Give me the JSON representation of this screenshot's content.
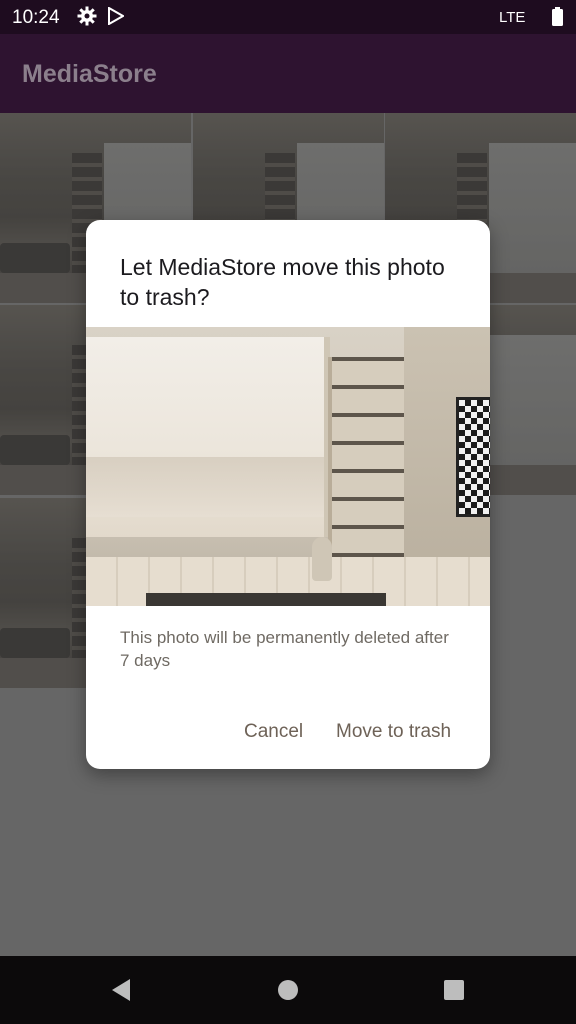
{
  "status_bar": {
    "time": "10:24",
    "network": "LTE",
    "icons": [
      "gear-icon",
      "play-store-icon",
      "battery-icon"
    ]
  },
  "app_bar": {
    "title": "MediaStore"
  },
  "dialog": {
    "title": "Let MediaStore move this photo to trash?",
    "message": "This photo will be permanently deleted after 7 days",
    "cancel_label": "Cancel",
    "confirm_label": "Move to trash"
  },
  "nav_bar": {
    "icons": [
      "back-icon",
      "home-icon",
      "recents-icon"
    ]
  },
  "colors": {
    "status_bar": "#1e0c1f",
    "app_bar": "#2e1330",
    "title_text": "#8b7f8c",
    "dialog_bg": "#ffffff",
    "button_text": "#6e6257"
  }
}
